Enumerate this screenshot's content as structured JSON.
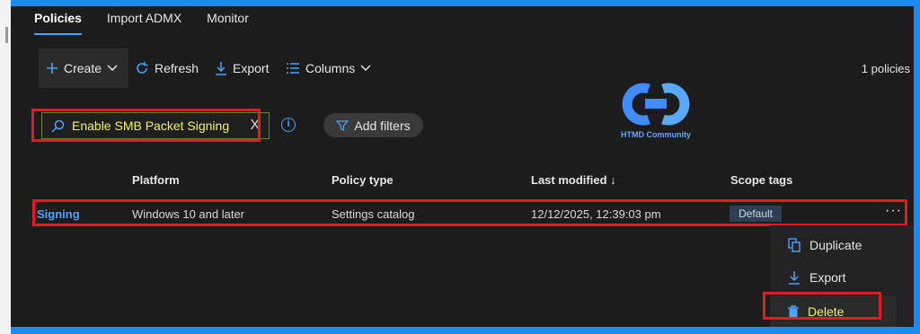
{
  "tabs": [
    {
      "label": "Policies",
      "active": true
    },
    {
      "label": "Import ADMX",
      "active": false
    },
    {
      "label": "Monitor",
      "active": false
    }
  ],
  "toolbar": {
    "create_label": "Create",
    "refresh_label": "Refresh",
    "export_label": "Export",
    "columns_label": "Columns",
    "policy_count": "1 policies"
  },
  "search": {
    "value": "Enable SMB Packet Signing",
    "clear_symbol": "X"
  },
  "filters": {
    "add_label": "Add filters"
  },
  "logo": {
    "caption": "HTMD Community"
  },
  "table": {
    "headers": {
      "platform": "Platform",
      "policy_type": "Policy type",
      "last_modified": "Last modified ↓",
      "scope_tags": "Scope tags"
    },
    "row": {
      "name": "Signing",
      "platform": "Windows 10 and later",
      "policy_type": "Settings catalog",
      "last_modified": "12/12/2025, 12:39:03 pm",
      "scope_tag": "Default",
      "more": "···"
    }
  },
  "context_menu": {
    "duplicate_label": "Duplicate",
    "export_label": "Export",
    "delete_label": "Delete"
  },
  "colors": {
    "accent": "#4aa3ff",
    "highlight_box": "#e21b24",
    "search_text": "#f2f26a",
    "frame_bg": "#1c1c1c",
    "border_bg": "#1a8cf0"
  },
  "icons": {
    "create": "plus-icon",
    "refresh": "refresh-icon",
    "export": "download-icon",
    "columns": "columns-icon",
    "search": "search-icon",
    "info": "info-icon",
    "filter": "filter-icon",
    "duplicate": "copy-icon",
    "delete": "trash-icon"
  }
}
